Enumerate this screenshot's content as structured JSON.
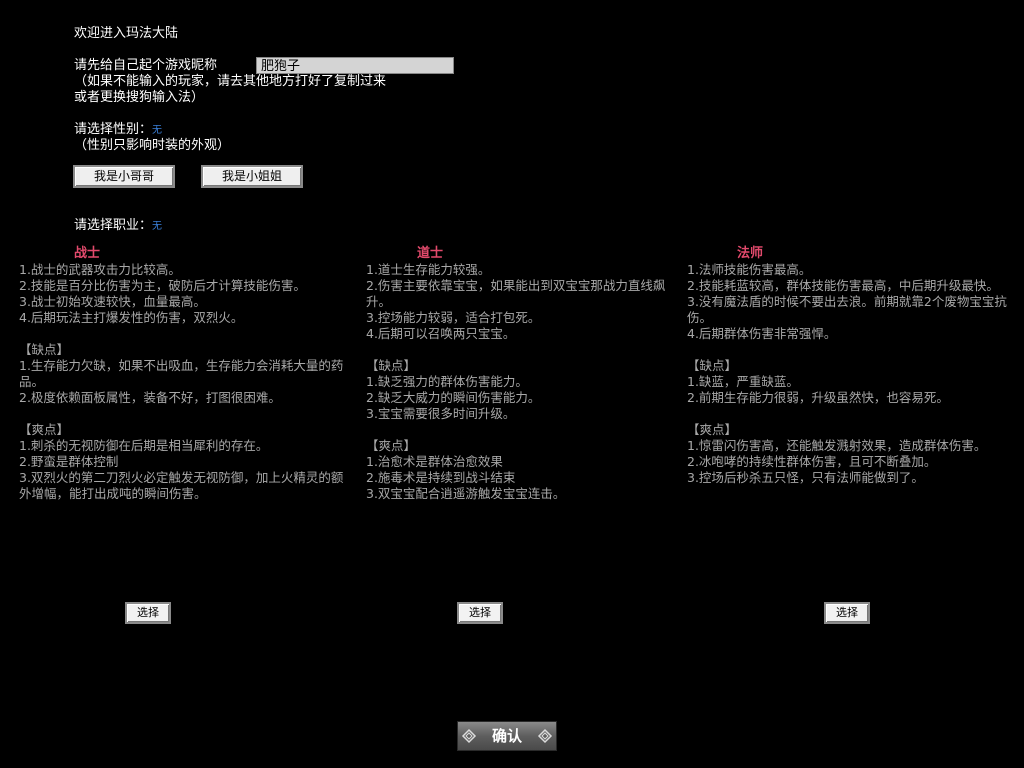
{
  "welcome": "欢迎进入玛法大陆",
  "nickname": {
    "prompt": "请先给自己起个游戏昵称",
    "value": "肥狍子",
    "hint_line1": "（如果不能输入的玩家，请去其他地方打好了复制过来",
    "hint_line2": "或者更换搜狗输入法）"
  },
  "gender": {
    "prompt": "请选择性别：",
    "current": "无",
    "hint": "（性别只影响时装的外观）",
    "male_button": "我是小哥哥",
    "female_button": "我是小姐姐"
  },
  "profession": {
    "prompt": "请选择职业：",
    "current": "无"
  },
  "classes": [
    {
      "name": "战士",
      "lines": [
        "1.战士的武器攻击力比较高。",
        "2.技能是百分比伤害为主，破防后才计算技能伤害。",
        "3.战士初始攻速较快，血量最高。",
        "4.后期玩法主打爆发性的伤害，双烈火。",
        "",
        "【缺点】",
        "1.生存能力欠缺，如果不出吸血，生存能力会消耗大量的药品。",
        "2.极度依赖面板属性，装备不好，打图很困难。",
        "",
        "【爽点】",
        "1.刺杀的无视防御在后期是相当犀利的存在。",
        "2.野蛮是群体控制",
        "3.双烈火的第二刀烈火必定触发无视防御，加上火精灵的额外增幅，能打出成吨的瞬间伤害。"
      ],
      "select_label": "选择"
    },
    {
      "name": "道士",
      "lines": [
        "1.道士生存能力较强。",
        "2.伤害主要依靠宝宝，如果能出到双宝宝那战力直线飙升。",
        "3.控场能力较弱，适合打包死。",
        "4.后期可以召唤两只宝宝。",
        "",
        "【缺点】",
        "1.缺乏强力的群体伤害能力。",
        "2.缺乏大威力的瞬间伤害能力。",
        "3.宝宝需要很多时间升级。",
        "",
        "【爽点】",
        "1.治愈术是群体治愈效果",
        "2.施毒术是持续到战斗结束",
        "3.双宝宝配合逍遥游触发宝宝连击。"
      ],
      "select_label": "选择"
    },
    {
      "name": "法师",
      "lines": [
        "1.法师技能伤害最高。",
        "2.技能耗蓝较高，群体技能伤害最高，中后期升级最快。",
        "3.没有魔法盾的时候不要出去浪。前期就靠2个废物宝宝抗伤。",
        "4.后期群体伤害非常强悍。",
        "",
        "【缺点】",
        "1.缺蓝，严重缺蓝。",
        "2.前期生存能力很弱，升级虽然快，也容易死。",
        "",
        "【爽点】",
        "1.惊雷闪伤害高，还能触发溅射效果，造成群体伤害。",
        "2.冰咆哮的持续性群体伤害，且可不断叠加。",
        "3.控场后秒杀五只怪，只有法师能做到了。"
      ],
      "select_label": "选择"
    }
  ],
  "confirm_label": "确认"
}
